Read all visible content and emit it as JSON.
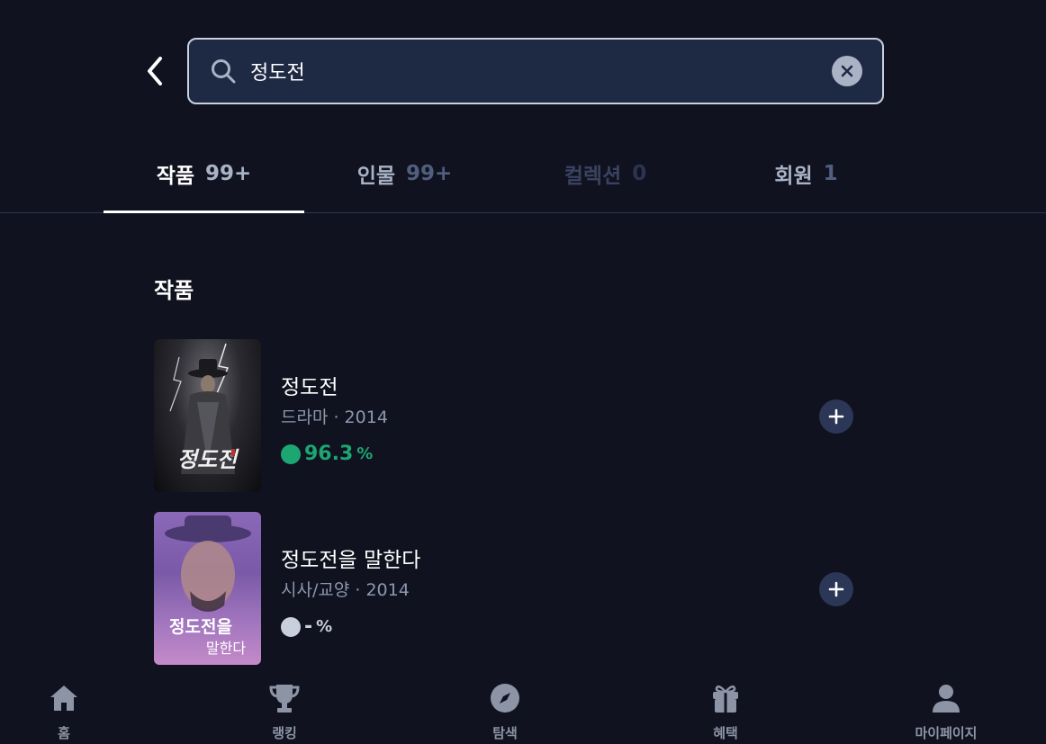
{
  "search": {
    "value": "정도전"
  },
  "tabs": [
    {
      "label": "작품",
      "count": "99+",
      "label_color": "#ffffff",
      "count_color": "#aab3c6"
    },
    {
      "label": "인물",
      "count": "99+",
      "label_color": "#aab3c6",
      "count_color": "#525e7e"
    },
    {
      "label": "컬렉션",
      "count": "0",
      "label_color": "#3a4260",
      "count_color": "#2c3450"
    },
    {
      "label": "회원",
      "count": "1",
      "label_color": "#aab3c6",
      "count_color": "#525e7e"
    }
  ],
  "section": {
    "title": "작품"
  },
  "results": [
    {
      "title": "정도전",
      "meta": "드라마 · 2014",
      "score": "96.3",
      "score_unit": "%",
      "score_color": "#1ca672",
      "poster_text": "정도전"
    },
    {
      "title": "정도전을 말한다",
      "meta": "시사/교양 · 2014",
      "score": "-",
      "score_unit": "%",
      "score_color": "#c9cfdc",
      "poster_text_1": "정도전을",
      "poster_text_2": "말한다"
    }
  ],
  "bottom_nav": [
    {
      "label": "홈",
      "icon": "home-icon"
    },
    {
      "label": "랭킹",
      "icon": "trophy-icon"
    },
    {
      "label": "탐색",
      "icon": "compass-icon"
    },
    {
      "label": "혜택",
      "icon": "gift-icon"
    },
    {
      "label": "마이페이지",
      "icon": "person-icon"
    }
  ],
  "colors": {
    "background": "#10121f",
    "search_bg": "#1e2944",
    "accent_green": "#1ca672"
  }
}
